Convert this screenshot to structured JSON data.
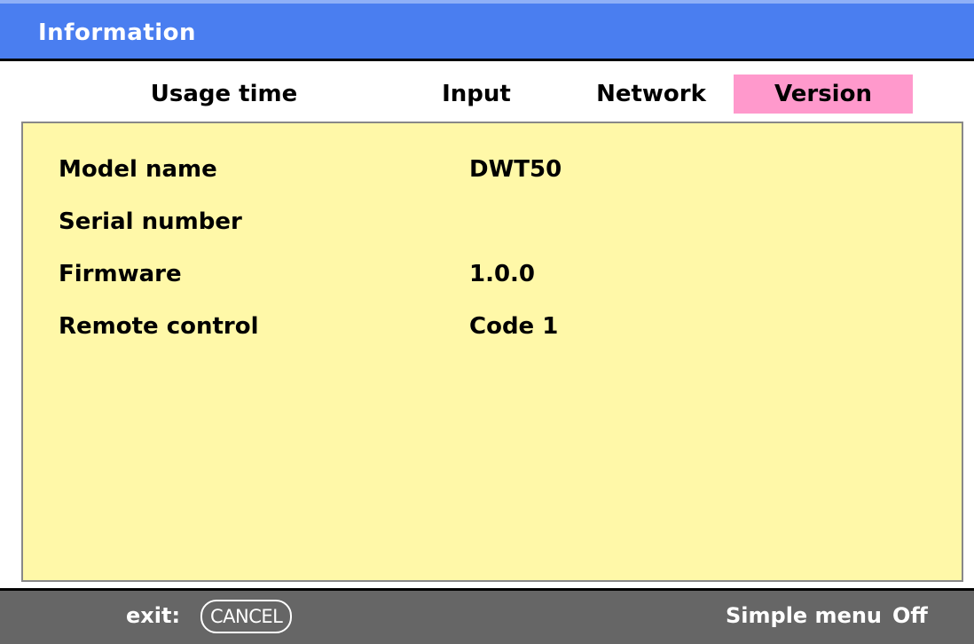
{
  "window": {
    "title": "Information"
  },
  "tabs": [
    {
      "label": "Usage time",
      "selected": false
    },
    {
      "label": "Input",
      "selected": false
    },
    {
      "label": "Network",
      "selected": false
    },
    {
      "label": "Version",
      "selected": true
    }
  ],
  "version_info": [
    {
      "label": "Model name",
      "value": "DWT50"
    },
    {
      "label": "Serial number",
      "value": ""
    },
    {
      "label": "Firmware",
      "value": "1.0.0"
    },
    {
      "label": "Remote control",
      "value": "Code 1"
    }
  ],
  "footer": {
    "exit_label": "exit:",
    "cancel_key": "CANCEL",
    "simple_menu_label": "Simple menu",
    "simple_menu_value": "Off"
  },
  "colors": {
    "title_bar": "#4a7ef0",
    "selected_tab": "#ff99cc",
    "content_background": "#fff8a8",
    "footer_background": "#666666"
  }
}
